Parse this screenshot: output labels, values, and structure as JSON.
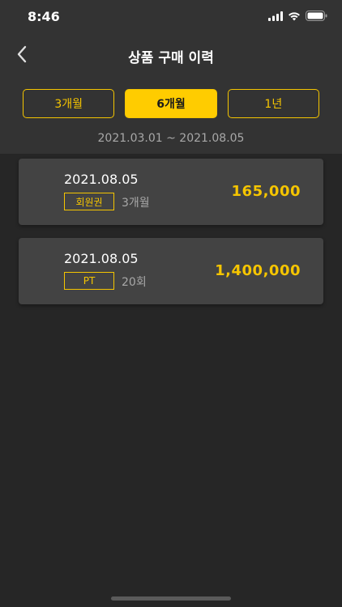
{
  "status_bar": {
    "time": "8:46",
    "icons": [
      "signal-icon",
      "wifi-icon",
      "battery-icon"
    ]
  },
  "nav": {
    "title": "상품 구매 이력",
    "back_icon": "chevron-left-icon"
  },
  "period_tabs": [
    {
      "label": "3개월",
      "active": false
    },
    {
      "label": "6개월",
      "active": true
    },
    {
      "label": "1년",
      "active": false
    }
  ],
  "date_range": "2021.03.01 ~ 2021.08.05",
  "purchases": [
    {
      "date": "2021.08.05",
      "type": "회원권",
      "duration": "3개월",
      "amount": "165,000"
    },
    {
      "date": "2021.08.05",
      "type": "PT",
      "duration": "20회",
      "amount": "1,400,000"
    }
  ],
  "colors": {
    "accent": "#ffcc00",
    "accent_text": "#f5c500",
    "background": "#262626",
    "header_background": "#333333",
    "card_background": "#434343",
    "muted_text": "#a8a8a8"
  }
}
